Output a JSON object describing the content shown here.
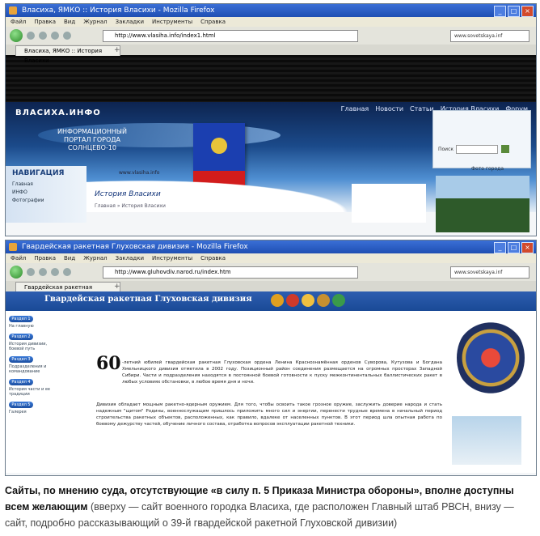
{
  "top_window": {
    "title": "Власиха, ЯМКО :: История Власихи - Mozilla Firefox",
    "menu": [
      "Файл",
      "Правка",
      "Вид",
      "Журнал",
      "Закладки",
      "Инструменты",
      "Справка"
    ],
    "url": "http://www.vlasiha.info/index1.html",
    "search_text": "www.sovetskaya.inf",
    "tab_label": "Власиха, ЯМКО :: История Власихи",
    "site": {
      "logo": "ВЛАСИХА.ИНФО",
      "top_nav": [
        "Главная",
        "Новости",
        "Статьи",
        "История Власихи",
        "Форум"
      ],
      "header_text": "ИНФОРМАЦИОННЫЙ ПОРТАЛ ГОРОДА СОЛНЦЕВО-10",
      "search_label": "Поиск",
      "sidebar_title": "НАВИГАЦИЯ",
      "sidebar_links": [
        "Главная",
        "ИНФО",
        "Фотографии"
      ],
      "site_link": "www.vlasiha.info",
      "page_title": "История Власихи",
      "breadcrumb": "Главная » История Власихи",
      "photo_caption": "Фото города"
    }
  },
  "bottom_window": {
    "title": "Гвардейская ракетная Глуховская дивизия - Mozilla Firefox",
    "menu": [
      "Файл",
      "Правка",
      "Вид",
      "Журнал",
      "Закладки",
      "Инструменты",
      "Справка"
    ],
    "url": "http://www.gluhovdiv.narod.ru/index.htm",
    "search_text": "www.sovetskaya.inf",
    "tab_label": "Гвардейская ракетная Глуховская...",
    "site": {
      "banner_title": "Гвардейская ракетная Глуховская дивизия",
      "left_nav": [
        {
          "pill": "Раздел 1",
          "text": "На главную"
        },
        {
          "pill": "Раздел 2",
          "text": "История дивизии, боевой путь"
        },
        {
          "pill": "Раздел 3",
          "text": "Подразделения и командование"
        },
        {
          "pill": "Раздел 4",
          "text": "История части и ее традиции"
        },
        {
          "pill": "Раздел 5",
          "text": "Галерея"
        }
      ],
      "big_year": "60",
      "paragraph_1": "-летний юбилей гвардейская ракетная Глуховская ордена Ленина Краснознамённая орденов Суворова, Кутузова и Богдана Хмельницкого дивизия отметила в 2002 году. Позиционный район соединения размещается на огромных просторах Западной Сибири. Части и подразделения находятся в постоянной боевой готовности к пуску межконтинентальных баллистических ракет в любых условиях обстановки, в любое время дня и ночи.",
      "paragraph_2": "Дивизия обладает мощным ракетно-ядерным оружием. Для того, чтобы освоить такое грозное оружие, заслужить доверие народа и стать надежным \"щитом\" Родины, военнослужащим пришлось приложить много сил и энергии, перенести трудные времена в начальный период строительства ракетных объектов, расположенных, как правило, вдалеке от населенных пунктов. В этот период шла опытная работа по боевому дежурству частей, обучение личного состава, отработка вопросов эксплуатации ракетной техники."
    }
  },
  "caption": {
    "bold": "Сайты, по мнению суда, отсутствующие «в силу п. 5 Приказа Министра обороны», вполне доступны всем желающим",
    "rest": " (вверху — сайт военного городка Власиха, где расположен Главный штаб РВСН, внизу — сайт, подробно рассказывающий о 39-й гвардейской ракетной Глуховской дивизии)"
  }
}
